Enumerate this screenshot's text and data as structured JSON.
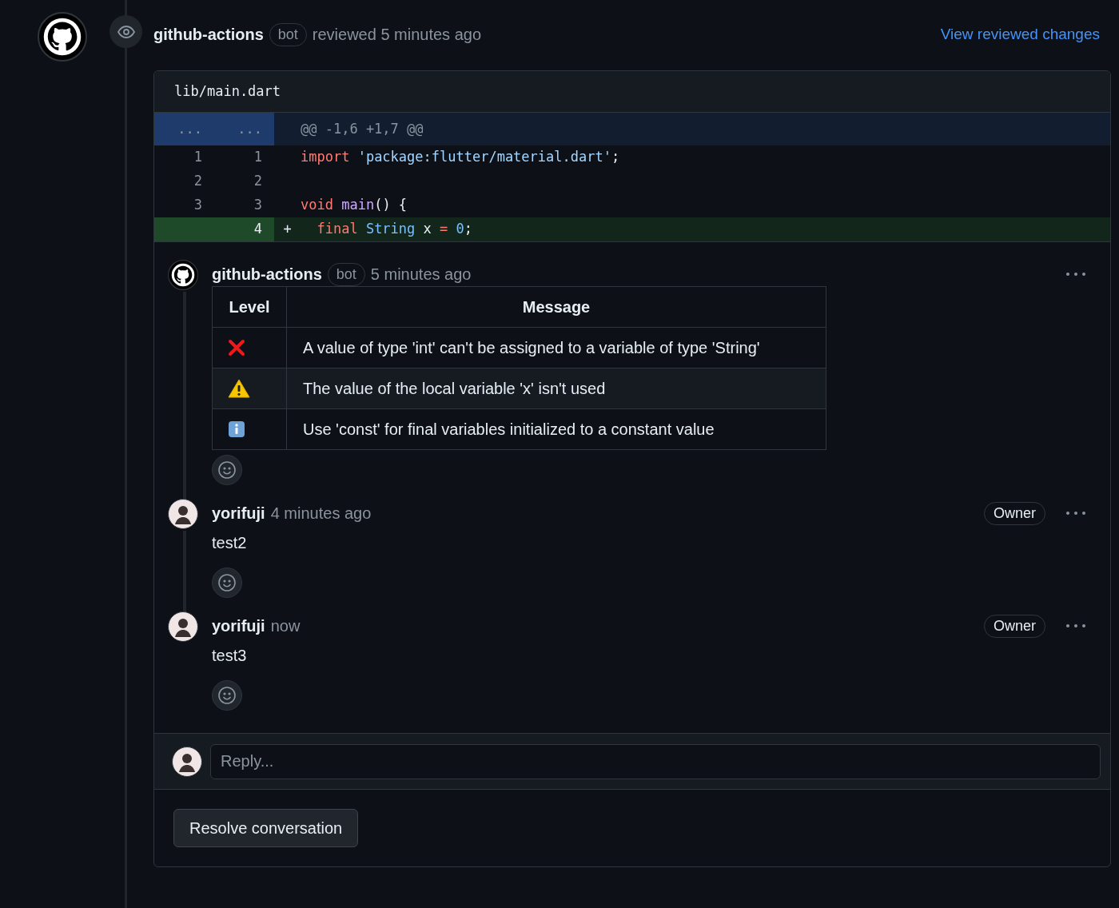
{
  "review": {
    "author": "github-actions",
    "badge": "bot",
    "action": "reviewed 5 minutes ago",
    "link": "View reviewed changes"
  },
  "file": {
    "path": "lib/main.dart",
    "lines": [
      {
        "kind": "hunk",
        "old": "...",
        "new": "...",
        "tokens": [
          {
            "kind": "meta",
            "text": "@@ -1,6 +1,7 @@"
          }
        ]
      },
      {
        "kind": "context",
        "old": "1",
        "new": "1",
        "tokens": [
          {
            "kind": "keyword",
            "text": "import"
          },
          {
            "kind": "string",
            "text": " 'package:flutter/material.dart'"
          },
          {
            "kind": "plain",
            "text": ";"
          }
        ]
      },
      {
        "kind": "context",
        "old": "2",
        "new": "2"
      },
      {
        "kind": "context",
        "old": "3",
        "new": "3",
        "tokens": [
          {
            "kind": "keyword",
            "text": "void"
          },
          {
            "kind": "function",
            "text": " main"
          },
          {
            "kind": "plain",
            "text": "() {"
          }
        ]
      },
      {
        "kind": "added",
        "new": "4",
        "sign": "+",
        "tokens": [
          {
            "kind": "keyword",
            "text": "  final"
          },
          {
            "kind": "type",
            "text": " String"
          },
          {
            "kind": "plain",
            "text": " x"
          },
          {
            "kind": "keyword",
            "text": " ="
          },
          {
            "kind": "number",
            "text": " 0"
          },
          {
            "kind": "plain",
            "text": ";"
          }
        ]
      }
    ]
  },
  "comments": [
    {
      "kind": "bot",
      "author": "github-actions",
      "badge": "bot",
      "time": "5 minutes ago",
      "table": {
        "columns": [
          "Level",
          "Message"
        ],
        "rows": [
          {
            "kind": "error",
            "message": "A value of type 'int' can't be assigned to a variable of type 'String'"
          },
          {
            "kind": "warning",
            "message": "The value of the local variable 'x' isn't used"
          },
          {
            "kind": "info",
            "message": "Use 'const' for final variables initialized to a constant value"
          }
        ]
      }
    },
    {
      "kind": "user",
      "author": "yorifuji",
      "time": "4 minutes ago",
      "role": "Owner",
      "body": "test2"
    },
    {
      "kind": "user",
      "author": "yorifuji",
      "time": "now",
      "role": "Owner",
      "body": "test3"
    }
  ],
  "reply": {
    "placeholder": "Reply..."
  },
  "resolve_button": "Resolve conversation"
}
